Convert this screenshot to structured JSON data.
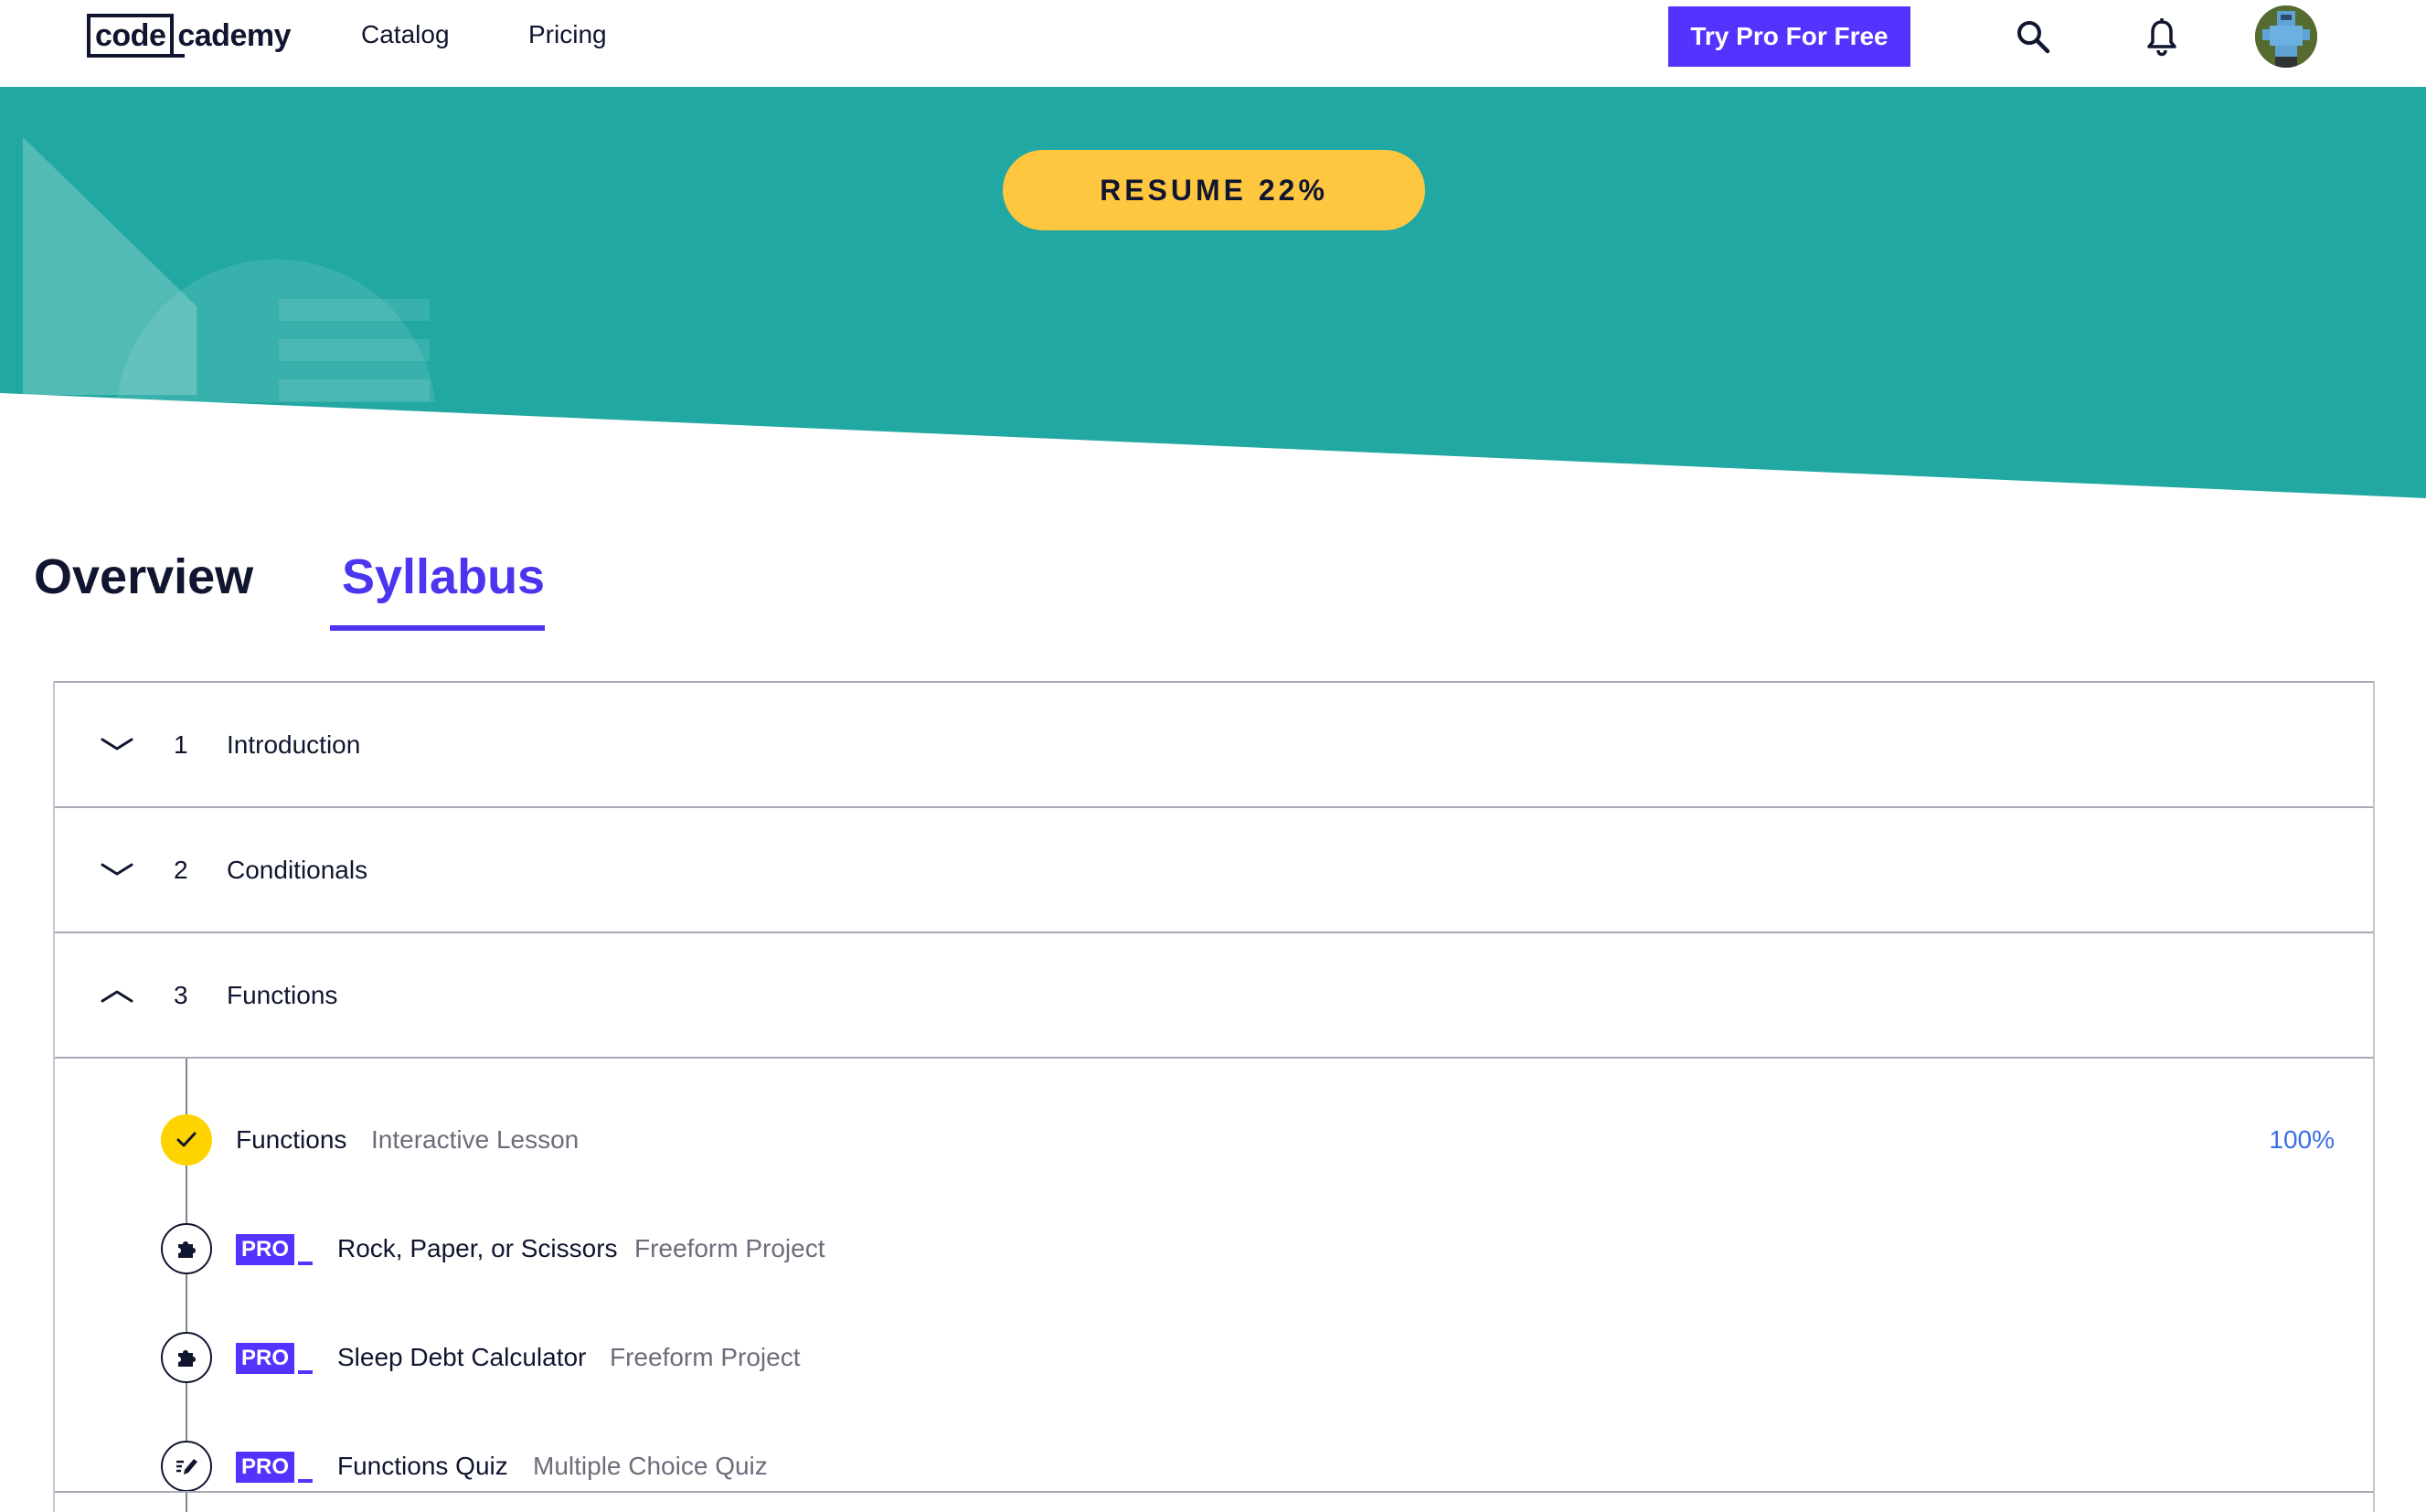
{
  "header": {
    "logo_code": "code",
    "logo_rest": "cademy",
    "nav": {
      "catalog": "Catalog",
      "pricing": "Pricing"
    },
    "pro_button": "Try Pro For Free"
  },
  "hero": {
    "resume_label": "RESUME 22%",
    "colors": {
      "teal": "#22a8a2",
      "button": "#ffc740"
    }
  },
  "tabs": {
    "overview": "Overview",
    "syllabus": "Syllabus",
    "active": "Syllabus"
  },
  "syllabus": {
    "modules": [
      {
        "number": "1",
        "title": "Introduction",
        "expanded": false
      },
      {
        "number": "2",
        "title": "Conditionals",
        "expanded": false
      },
      {
        "number": "3",
        "title": "Functions",
        "expanded": true
      }
    ],
    "items": [
      {
        "title": "Functions",
        "type": "Interactive Lesson",
        "progress": "100%",
        "completed": true,
        "pro": false,
        "icon": "check-icon"
      },
      {
        "title": "Rock, Paper, or Scissors",
        "type": "Freeform Project",
        "completed": false,
        "pro": true,
        "pro_label": "PRO",
        "icon": "puzzle-icon"
      },
      {
        "title": "Sleep Debt Calculator",
        "type": "Freeform Project",
        "completed": false,
        "pro": true,
        "pro_label": "PRO",
        "icon": "puzzle-icon"
      },
      {
        "title": "Functions Quiz",
        "type": "Multiple Choice Quiz",
        "completed": false,
        "pro": true,
        "pro_label": "PRO",
        "icon": "quiz-pencil-icon"
      }
    ]
  },
  "colors": {
    "brand_purple": "#5533ff",
    "text_dark": "#10162f",
    "progress_blue": "#3a6ee8",
    "completed_yellow": "#ffd300"
  }
}
